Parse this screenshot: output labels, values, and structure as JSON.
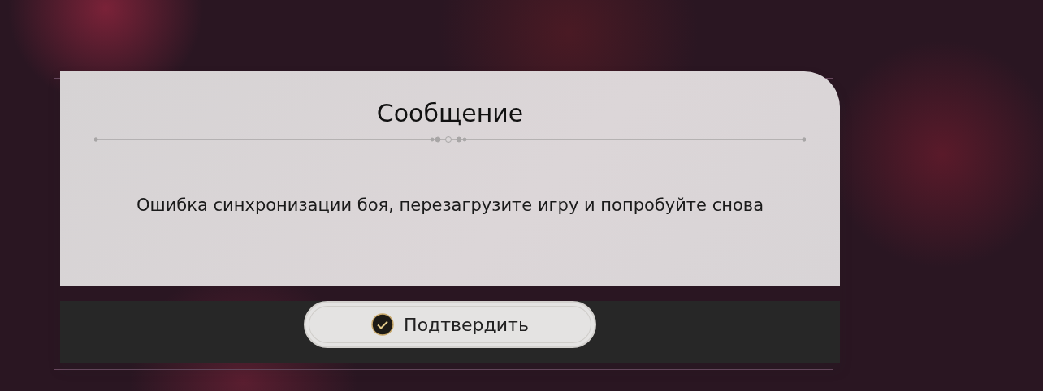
{
  "dialog": {
    "title": "Сообщение",
    "message": "Ошибка синхронизации боя, перезагрузите игру и попробуйте снова",
    "buttons": [
      {
        "label": "Подтвердить",
        "kind": "confirm"
      }
    ]
  }
}
